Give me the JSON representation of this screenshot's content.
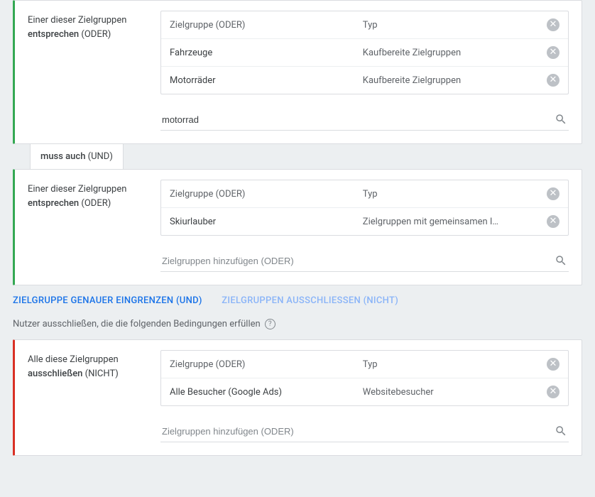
{
  "block1": {
    "left_line1": "Einer dieser Zielgruppen",
    "left_bold": "entsprechen",
    "left_suffix": " (ODER)",
    "header_a": "Zielgruppe (ODER)",
    "header_b": "Typ",
    "rows": [
      {
        "a": "Fahrzeuge",
        "b": "Kaufbereite Zielgruppen"
      },
      {
        "a": "Motorräder",
        "b": "Kaufbereite Zielgruppen"
      }
    ],
    "search_value": "motorrad"
  },
  "connector": {
    "bold": "muss auch",
    "suffix": " (UND)"
  },
  "block2": {
    "left_line1": "Einer dieser Zielgruppen",
    "left_bold": "entsprechen",
    "left_suffix": " (ODER)",
    "header_a": "Zielgruppe (ODER)",
    "header_b": "Typ",
    "rows": [
      {
        "a": "Skiurlauber",
        "b": "Zielgruppen mit gemeinsamen I…"
      }
    ],
    "search_placeholder": "Zielgruppen hinzufügen (ODER)"
  },
  "actions": {
    "narrow": "ZIELGRUPPE GENAUER EINGRENZEN (UND)",
    "exclude": "ZIELGRUPPEN AUSSCHLIESSEN (NICHT)"
  },
  "exclude_label": "Nutzer ausschließen, die die folgenden Bedingungen erfüllen",
  "block3": {
    "left_line1": "Alle diese Zielgruppen",
    "left_bold": "ausschließen",
    "left_suffix": " (NICHT)",
    "header_a": "Zielgruppe (ODER)",
    "header_b": "Typ",
    "rows": [
      {
        "a": "Alle Besucher (Google Ads)",
        "b": "Websitebesucher"
      }
    ],
    "search_placeholder": "Zielgruppen hinzufügen (ODER)"
  }
}
